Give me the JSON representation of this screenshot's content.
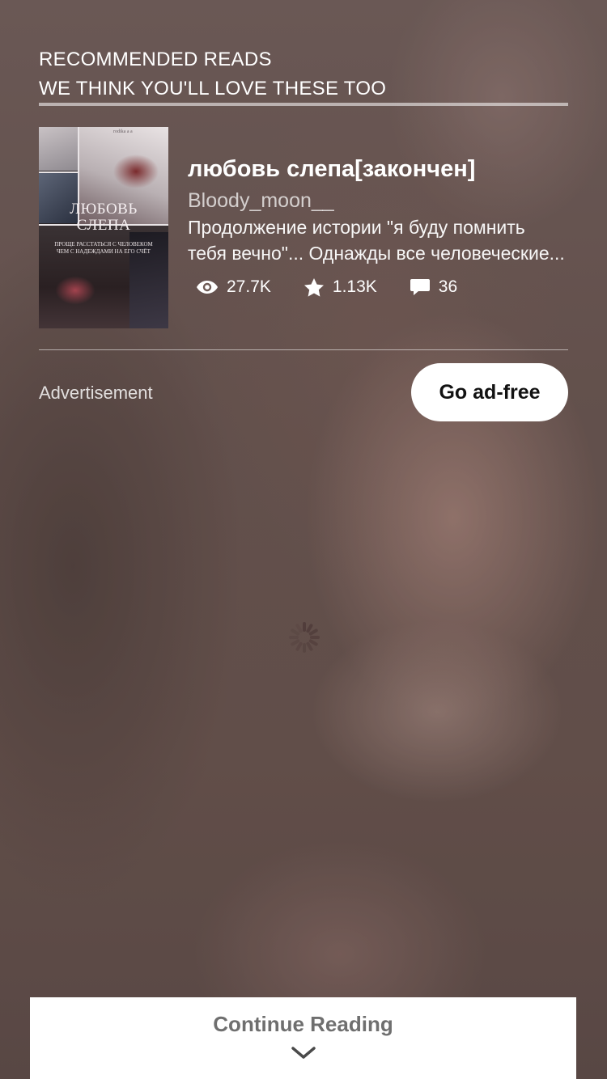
{
  "recommended": {
    "heading_line1": "RECOMMENDED READS",
    "heading_line2": "WE THINK YOU'LL LOVE THESE TOO"
  },
  "story": {
    "title": "любовь слепа[закончен]",
    "author": "Bloody_moon__",
    "description": "Продолжение истории \"я буду помнить тебя вечно\"... Однажды все человеческие...",
    "cover": {
      "title_line1": "ЛЮБОВЬ",
      "title_line2": "СЛЕПА",
      "subtitle_line1": "ПРОЩЕ РАССТАТЬСЯ С ЧЕЛОВЕКОМ",
      "subtitle_line2": "ЧЕМ С НАДЕЖДАМИ НА ЕГО СЧЁТ",
      "author": "rodika a a"
    },
    "stats": {
      "reads": "27.7K",
      "reads_icon": "eye-icon",
      "votes": "1.13K",
      "votes_icon": "star-icon",
      "comments": "36",
      "comments_icon": "comment-icon"
    }
  },
  "ad": {
    "label": "Advertisement",
    "go_adfree": "Go ad-free"
  },
  "footer": {
    "continue_label": "Continue Reading",
    "continue_icon": "chevron-down-icon"
  },
  "colors": {
    "background": "#6e5b56",
    "button_bg": "#ffffff",
    "button_text": "#121212",
    "continue_text": "#6f6f6f"
  }
}
